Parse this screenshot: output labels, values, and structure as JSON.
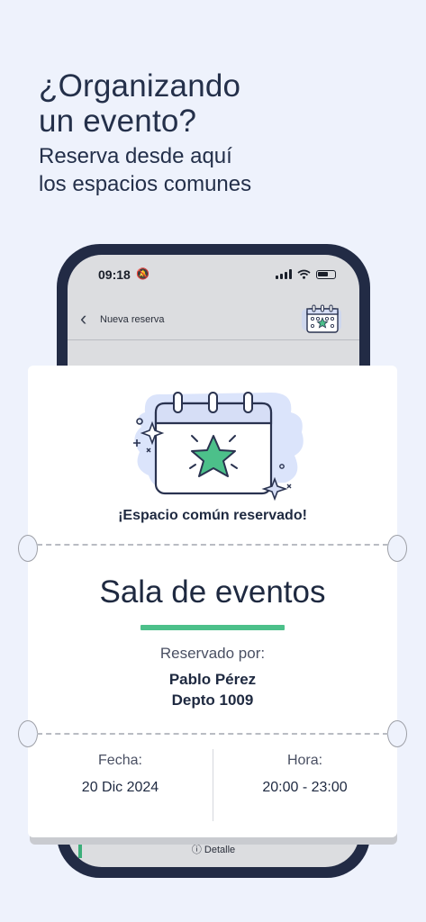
{
  "headline": {
    "title_line1": "¿Organizando",
    "title_line2": "un evento?",
    "subtitle_line1": "Reserva desde aquí",
    "subtitle_line2": "los espacios comunes"
  },
  "phone": {
    "status_time": "09:18",
    "nav_title": "Nueva reserva",
    "detail_button": "ⓘ Detalle"
  },
  "ticket": {
    "message": "¡Espacio común reservado!",
    "space_name": "Sala de eventos",
    "reserved_by_label": "Reservado por:",
    "reserved_by_name": "Pablo Pérez",
    "reserved_by_unit": "Depto 1009",
    "date_label": "Fecha:",
    "date_value": "20 Dic 2024",
    "time_label": "Hora:",
    "time_value": "20:00 - 23:00"
  },
  "colors": {
    "background": "#eef2fc",
    "phone_frame": "#222b45",
    "accent_green": "#4cc08a",
    "text_dark": "#1e2940"
  },
  "icons": [
    "back-chevron-icon",
    "calendar-star-icon",
    "signal-icon",
    "wifi-icon",
    "battery-icon",
    "silent-bell-icon",
    "info-icon"
  ]
}
